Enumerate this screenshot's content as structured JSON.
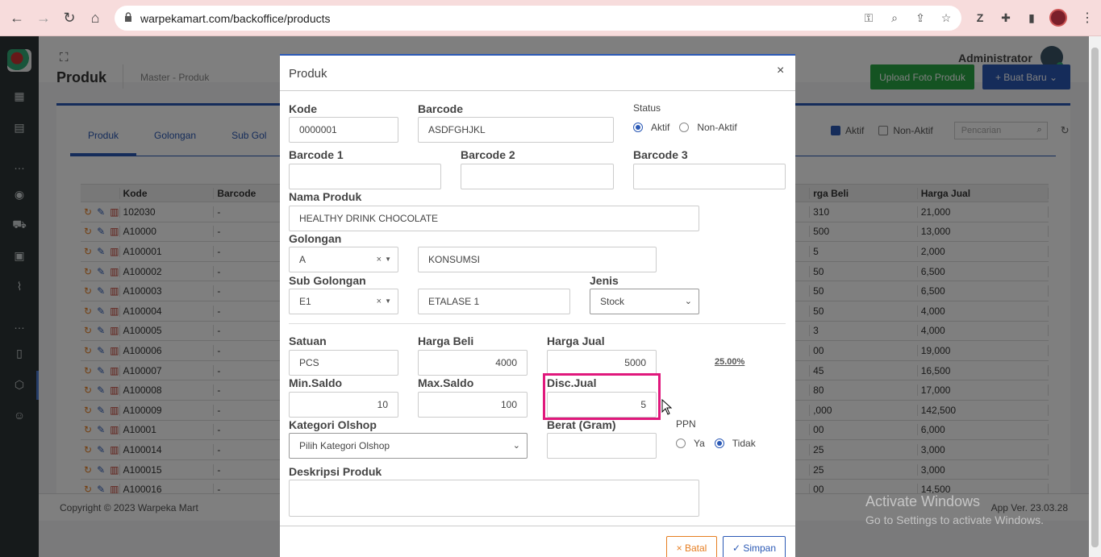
{
  "browser": {
    "url": "warpekamart.com/backoffice/products"
  },
  "topbar": {
    "user": "Administrator"
  },
  "page": {
    "title": "Produk",
    "breadcrumb": "Master  -  Produk",
    "upload_button": "Upload Foto Produk",
    "new_button": "+ Buat Baru",
    "tabs": [
      "Produk",
      "Golongan",
      "Sub Gol"
    ],
    "filter_active": "Aktif",
    "filter_inactive": "Non-Aktif",
    "search_placeholder": "Pencarian",
    "table": {
      "headers": {
        "kode": "Kode",
        "barcode": "Barcode",
        "harga_beli": "rga Beli",
        "harga_jual": "Harga Jual"
      },
      "rows": [
        {
          "kode": "102030",
          "barcode": "-",
          "harga_beli": "310",
          "harga_jual": "21,000"
        },
        {
          "kode": "A10000",
          "barcode": "-",
          "harga_beli": "500",
          "harga_jual": "13,000"
        },
        {
          "kode": "A100001",
          "barcode": "-",
          "harga_beli": "5",
          "harga_jual": "2,000"
        },
        {
          "kode": "A100002",
          "barcode": "-",
          "harga_beli": "50",
          "harga_jual": "6,500"
        },
        {
          "kode": "A100003",
          "barcode": "-",
          "harga_beli": "50",
          "harga_jual": "6,500"
        },
        {
          "kode": "A100004",
          "barcode": "-",
          "harga_beli": "50",
          "harga_jual": "4,000"
        },
        {
          "kode": "A100005",
          "barcode": "-",
          "harga_beli": "3",
          "harga_jual": "4,000"
        },
        {
          "kode": "A100006",
          "barcode": "-",
          "harga_beli": "00",
          "harga_jual": "19,000"
        },
        {
          "kode": "A100007",
          "barcode": "-",
          "harga_beli": "45",
          "harga_jual": "16,500"
        },
        {
          "kode": "A100008",
          "barcode": "-",
          "harga_beli": "80",
          "harga_jual": "17,000"
        },
        {
          "kode": "A100009",
          "barcode": "-",
          "harga_beli": ",000",
          "harga_jual": "142,500"
        },
        {
          "kode": "A10001",
          "barcode": "-",
          "harga_beli": "00",
          "harga_jual": "6,000"
        },
        {
          "kode": "A100014",
          "barcode": "-",
          "harga_beli": "25",
          "harga_jual": "3,000"
        },
        {
          "kode": "A100015",
          "barcode": "-",
          "harga_beli": "25",
          "harga_jual": "3,000"
        },
        {
          "kode": "A100016",
          "barcode": "-",
          "harga_beli": "00",
          "harga_jual": "14,500"
        }
      ]
    },
    "footer_copy": "Copyright © 2023 Warpeka Mart",
    "footer_version": "App Ver. 23.03.28"
  },
  "watermark": {
    "line1": "Activate Windows",
    "line2": "Go to Settings to activate Windows."
  },
  "modal": {
    "title": "Produk",
    "close": "×",
    "kode_label": "Kode",
    "kode_value": "0000001",
    "barcode_label": "Barcode",
    "barcode_value": "ASDFGHJKL",
    "status_label": "Status",
    "status_active": "Aktif",
    "status_inactive": "Non-Aktif",
    "barcode1_label": "Barcode 1",
    "barcode2_label": "Barcode 2",
    "barcode3_label": "Barcode 3",
    "nama_label": "Nama Produk",
    "nama_value": "HEALTHY DRINK CHOCOLATE",
    "golongan_label": "Golongan",
    "golongan_code": "A",
    "golongan_name": "KONSUMSI",
    "subgol_label": "Sub Golongan",
    "subgol_code": "E1",
    "subgol_name": "ETALASE 1",
    "jenis_label": "Jenis",
    "jenis_value": "Stock",
    "satuan_label": "Satuan",
    "satuan_value": "PCS",
    "harga_beli_label": "Harga Beli",
    "harga_beli_value": "4000",
    "harga_jual_label": "Harga Jual",
    "harga_jual_value": "5000",
    "margin": "25.00%",
    "min_saldo_label": "Min.Saldo",
    "min_saldo_value": "10",
    "max_saldo_label": "Max.Saldo",
    "max_saldo_value": "100",
    "disc_label": "Disc.Jual",
    "disc_value": "5",
    "kategori_label": "Kategori Olshop",
    "kategori_value": "Pilih Kategori Olshop",
    "berat_label": "Berat (Gram)",
    "ppn_label": "PPN",
    "ppn_yes": "Ya",
    "ppn_no": "Tidak",
    "deskripsi_label": "Deskripsi Produk",
    "cancel_button": "× Batal",
    "save_button": "✓ Simpan"
  },
  "colors": {
    "accent": "#2b59b5",
    "success": "#28a745",
    "highlight": "#e0187c"
  }
}
